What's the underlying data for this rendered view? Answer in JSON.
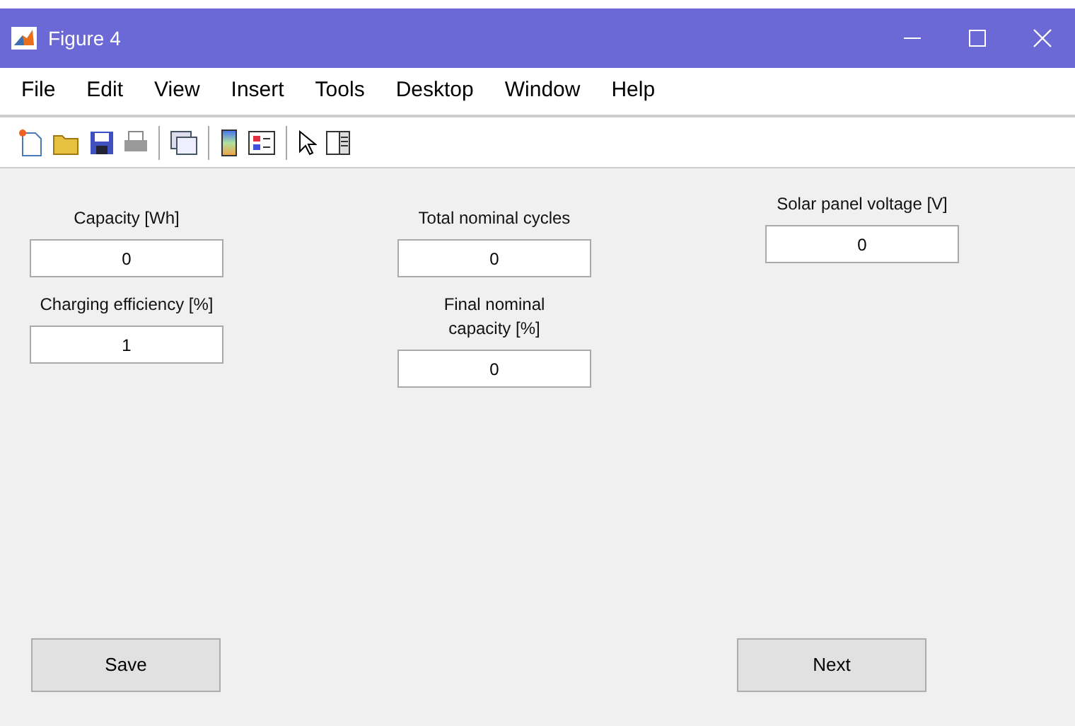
{
  "window": {
    "title": "Figure 4"
  },
  "menu": [
    "File",
    "Edit",
    "View",
    "Insert",
    "Tools",
    "Desktop",
    "Window",
    "Help"
  ],
  "columns": [
    {
      "fields": [
        {
          "label": "Capacity [Wh]",
          "value": "0"
        },
        {
          "label": "Charging efficiency [%]",
          "value": "1"
        }
      ]
    },
    {
      "fields": [
        {
          "label": "Total nominal cycles",
          "value": "0"
        },
        {
          "label": "Final nominal capacity [%]",
          "value": "0"
        }
      ]
    },
    {
      "fields": [
        {
          "label": "Solar panel voltage [V]",
          "value": "0"
        }
      ]
    }
  ],
  "buttons": [
    "Save",
    "Next"
  ]
}
